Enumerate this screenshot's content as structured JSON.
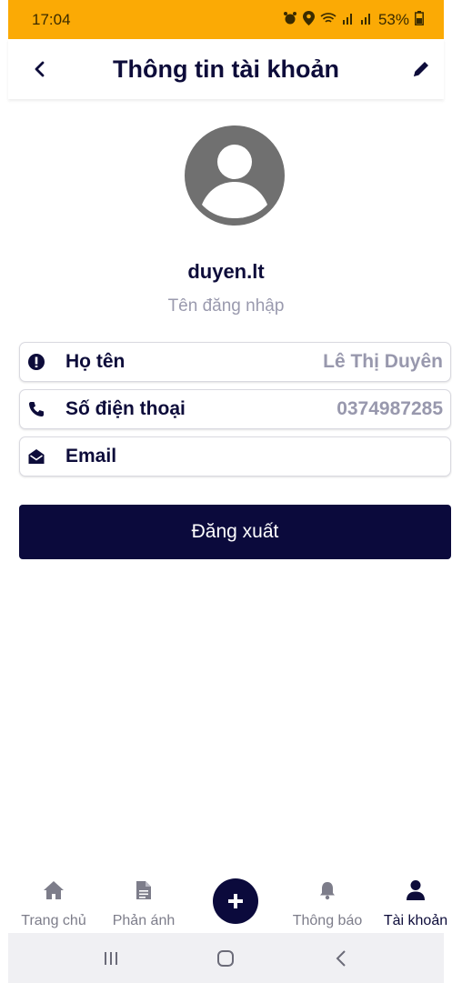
{
  "status_bar": {
    "time": "17:04",
    "battery": "53%",
    "icons": [
      "alarm-icon",
      "location-icon",
      "wifi-icon",
      "signal-icon",
      "signal-icon",
      "battery-icon"
    ]
  },
  "app_bar": {
    "title": "Thông tin tài khoản",
    "back_icon": "chevron-left-icon",
    "edit_icon": "pencil-icon"
  },
  "profile": {
    "username": "duyen.lt",
    "username_caption": "Tên đăng nhập",
    "avatar_icon": "user-circle-icon"
  },
  "info_rows": [
    {
      "icon": "id-circle-icon",
      "label": "Họ tên",
      "value": "Lê Thị Duyên"
    },
    {
      "icon": "phone-icon",
      "label": "Số điện thoại",
      "value": "0374987285"
    },
    {
      "icon": "envelope-open-icon",
      "label": "Email",
      "value": ""
    }
  ],
  "logout_label": "Đăng xuất",
  "bottom_nav": {
    "items": [
      {
        "icon": "home-icon",
        "label": "Trang chủ",
        "active": false
      },
      {
        "icon": "document-icon",
        "label": "Phản ánh",
        "active": false
      },
      {
        "icon": "plus-circle-icon",
        "label": "",
        "active": false
      },
      {
        "icon": "bell-icon",
        "label": "Thông báo",
        "active": false
      },
      {
        "icon": "user-icon",
        "label": "Tài khoản",
        "active": true
      }
    ]
  },
  "colors": {
    "status_bar": "#FBAA05",
    "primary": "#0B0A3C",
    "muted_text": "#9898AD",
    "inactive_nav": "#7D7D8A"
  }
}
